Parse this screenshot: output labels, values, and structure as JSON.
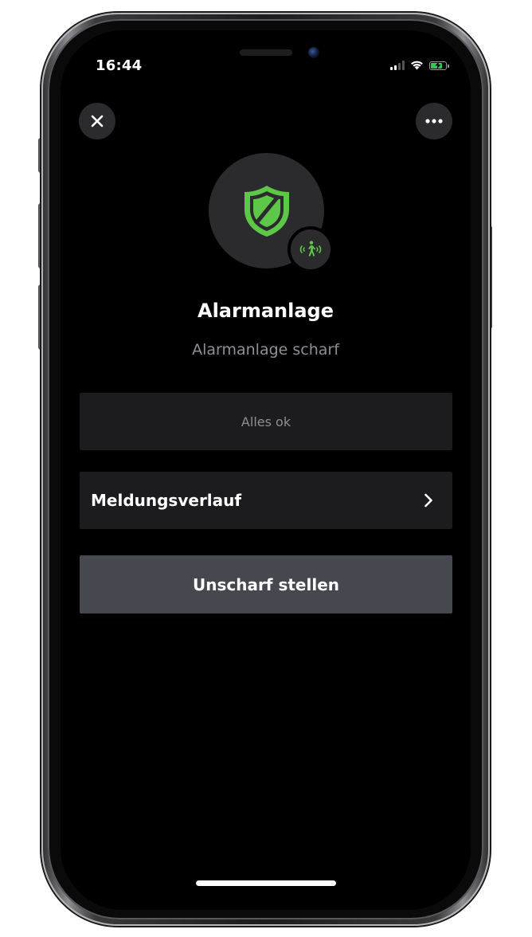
{
  "status_bar": {
    "time": "16:44",
    "signal_icon": "cellular-signal-icon",
    "wifi_icon": "wifi-icon",
    "battery_icon": "battery-charging-icon",
    "battery_percent": 85
  },
  "header": {
    "close_icon": "close-icon",
    "more_icon": "more-horizontal-icon"
  },
  "device": {
    "icon": "shield-icon",
    "badge_icon": "motion-sensor-icon",
    "name": "Alarmanlage",
    "status": "Alarmanlage scharf"
  },
  "info_panel": {
    "message": "Alles ok"
  },
  "history": {
    "label": "Meldungsverlauf",
    "chevron_icon": "chevron-right-icon"
  },
  "actions": {
    "disarm_label": "Unscharf stellen"
  },
  "colors": {
    "background": "#000000",
    "surface": "#1c1c1e",
    "button": "#45494f",
    "accent_green": "#5dc847",
    "muted_text": "#8e8e96"
  }
}
